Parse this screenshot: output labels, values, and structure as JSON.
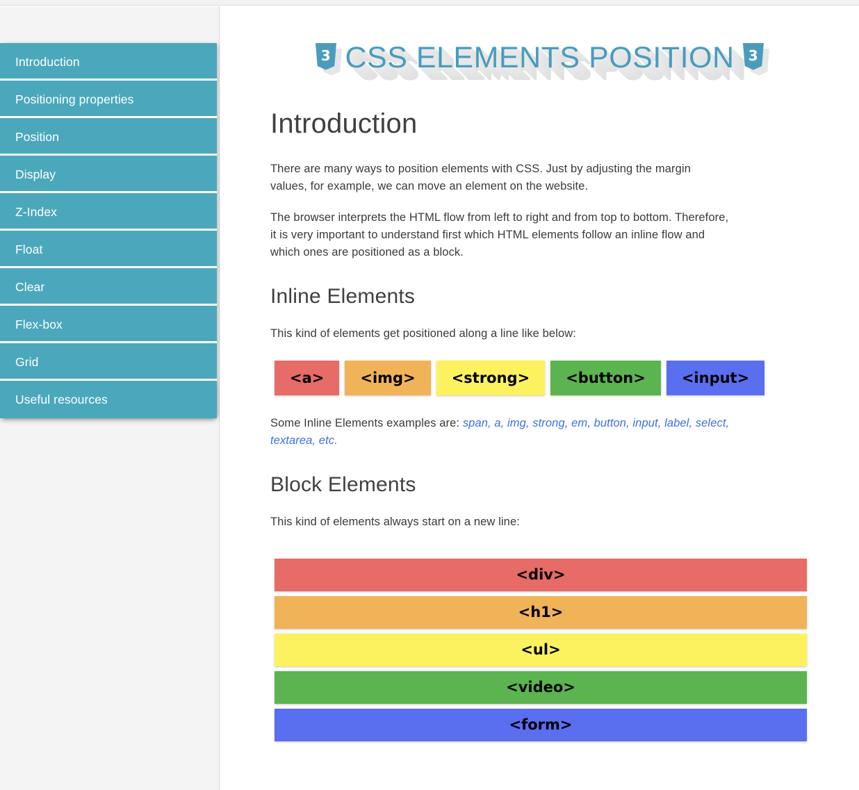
{
  "sidebar": {
    "items": [
      {
        "label": "Introduction"
      },
      {
        "label": "Positioning properties"
      },
      {
        "label": "Position"
      },
      {
        "label": "Display"
      },
      {
        "label": "Z-Index"
      },
      {
        "label": "Float"
      },
      {
        "label": "Clear"
      },
      {
        "label": "Flex-box"
      },
      {
        "label": "Grid"
      },
      {
        "label": "Useful resources"
      }
    ]
  },
  "header": {
    "title": "CSS ELEMENTS POSITION",
    "left_icon": "css3-logo-icon",
    "right_icon": "css3-logo-icon",
    "title_color": "#4a9cbd"
  },
  "main": {
    "intro": {
      "heading": "Introduction",
      "paragraphs": [
        "There are many ways to position elements with CSS. Just by adjusting the margin values, for example, we can move an element on the website.",
        "The browser interprets the HTML flow from left to right and from top to bottom. Therefore, it is very important to understand first which HTML elements follow an inline flow and which ones are positioned as a block."
      ]
    },
    "inline_section": {
      "heading": "Inline Elements",
      "lead": "This kind of elements get positioned along a line like below:",
      "boxes": [
        {
          "label": "<a>",
          "color": "#e76b66"
        },
        {
          "label": "<img>",
          "color": "#f0b357"
        },
        {
          "label": "<strong>",
          "color": "#fcf25f"
        },
        {
          "label": "<button>",
          "color": "#5cb450"
        },
        {
          "label": "<input>",
          "color": "#5a6ef0"
        }
      ],
      "examples_prefix": "Some Inline Elements examples are: ",
      "examples_list": "span, a, img, strong, em, button, input, label, select, textarea, etc."
    },
    "block_section": {
      "heading": "Block Elements",
      "lead": "This kind of elements always start on a new line:",
      "bars": [
        {
          "label": "<div>",
          "color": "#e76b66"
        },
        {
          "label": "<h1>",
          "color": "#f0b357"
        },
        {
          "label": "<ul>",
          "color": "#fcf25f"
        },
        {
          "label": "<video>",
          "color": "#5cb450"
        },
        {
          "label": "<form>",
          "color": "#5a6ef0"
        }
      ]
    }
  },
  "theme": {
    "nav_color": "#4ba8bc",
    "sidebar_bg": "#f4f4f4",
    "link_color": "#3c6fe8",
    "text_color": "#3a3a3a"
  }
}
